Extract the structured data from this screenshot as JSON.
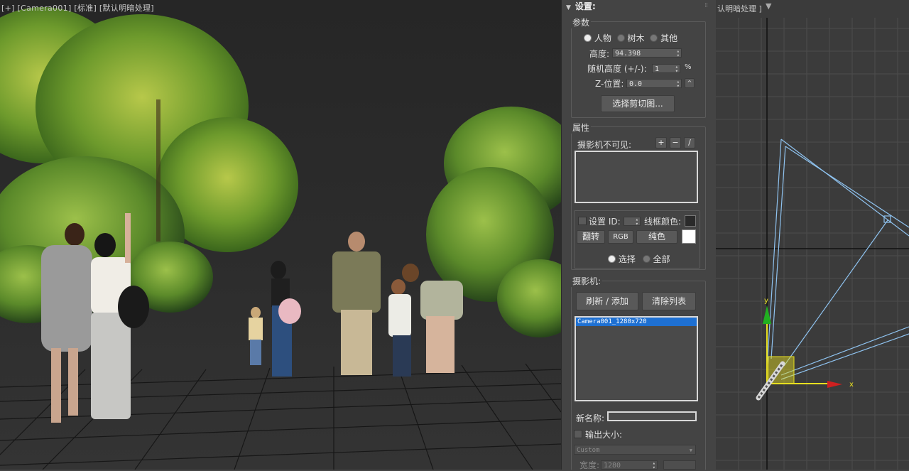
{
  "viewport_left": {
    "label": "[+] [Camera001] [标准] [默认明暗处理]"
  },
  "viewport_right": {
    "label": "认明暗处理 ]"
  },
  "panel": {
    "rollout_title": "设置",
    "params": {
      "group_title": "参数",
      "radios": [
        "人物",
        "树木",
        "其他"
      ],
      "height_label": "高度:",
      "height_value": "94.398",
      "random_height_label": "随机高度 (+/-):",
      "random_height_value": "1",
      "percent": "%",
      "z_label": "Z-位置:",
      "z_value": "0.0",
      "select_clip_button": "选择剪切图..."
    },
    "properties": {
      "group_title": "属性",
      "camera_invisible_label": "摄影机不可见:",
      "plus": "+",
      "minus": "−",
      "slash": "/",
      "set_id_label": "设置 ID:",
      "wire_color_label": "线框颜色:",
      "flip_button": "翻转",
      "rgb_button": "RGB",
      "solid_button": "纯色",
      "select_radio": "选择",
      "all_radio": "全部"
    },
    "camera": {
      "group_title": "摄影机:",
      "refresh_button": "刷新 / 添加",
      "clear_button": "清除列表",
      "items": [
        "Camera001_1280x720"
      ],
      "new_name_label": "新名称:",
      "output_size_label": "输出大小:",
      "preset_value": "Custom",
      "width_label": "宽度:",
      "width_value": "1280"
    }
  },
  "gizmo": {
    "axis_x": "x",
    "axis_y": "y"
  },
  "colors": {
    "selection": "#1e70d2",
    "wire_line": "#8fc3f0",
    "gizmo_yellow": "#e8e020",
    "axis_x": "#d02020",
    "axis_y": "#20b020"
  }
}
